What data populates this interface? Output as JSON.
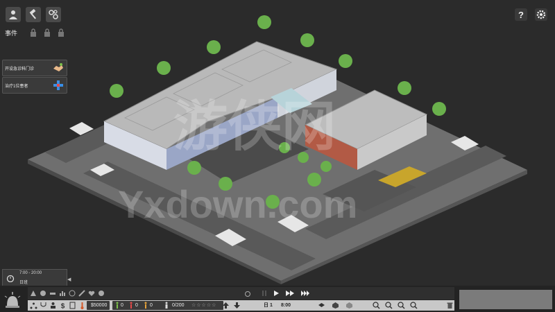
{
  "events": {
    "label": "事件"
  },
  "tasks": [
    {
      "label": "开设急诊科门诊"
    },
    {
      "label": "治疗1位患者"
    }
  ],
  "time_panel": {
    "hours": "7:00 - 20:00",
    "day_label": "日班"
  },
  "status_bar": {
    "money": "$50000",
    "patients_treated": "0",
    "patients_died": "0",
    "patients_left": "0",
    "capacity": "0/200",
    "day": "日 1",
    "clock": "8:00"
  },
  "watermark": {
    "cn": "游侠网",
    "en": "Yxdown.com"
  },
  "colors": {
    "background": "#2b2b2b",
    "panel": "#3a3a3a",
    "stat_strip": "#c8c8c8",
    "accent_green": "#7cc04b",
    "accent_blue": "#3a8ee6"
  }
}
